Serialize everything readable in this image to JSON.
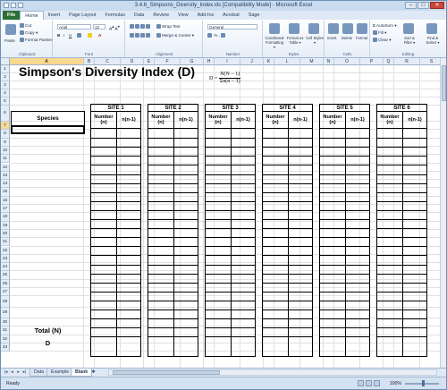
{
  "window": {
    "title": "3.4.6_Simpsons_Diversity_Index.xls [Compatibility Mode] - Microsoft Excel"
  },
  "ribbon_tabs": [
    "File",
    "Home",
    "Insert",
    "Page Layout",
    "Formulas",
    "Data",
    "Review",
    "View",
    "Add-Ins",
    "Acrobat",
    "Sage"
  ],
  "ribbon": {
    "clipboard": {
      "paste": "Paste",
      "cut": "Cut",
      "copy": "Copy ▾",
      "format_painter": "Format Painter",
      "label": "Clipboard"
    },
    "font": {
      "name": "Arial",
      "size": "12",
      "label": "Font"
    },
    "alignment": {
      "wrap": "Wrap Text",
      "merge": "Merge & Center ▾",
      "label": "Alignment"
    },
    "number": {
      "format": "General",
      "label": "Number"
    },
    "styles": {
      "conditional": "Conditional Formatting ▾",
      "format_table": "Format as Table ▾",
      "cell_styles": "Cell Styles ▾",
      "label": "Styles"
    },
    "cells": {
      "insert": "Insert",
      "delete": "Delete",
      "format": "Format",
      "label": "Cells"
    },
    "editing": {
      "autosum": "AutoSum ▾",
      "fill": "Fill ▾",
      "clear": "Clear ▾",
      "sort": "Sort & Filter ▾",
      "find": "Find & Select ▾",
      "label": "Editing"
    }
  },
  "columns": [
    "A",
    "B",
    "C",
    "D",
    "E",
    "F",
    "G",
    "H",
    "I",
    "J",
    "K",
    "L",
    "M",
    "N",
    "O",
    "P",
    "Q",
    "R",
    "S"
  ],
  "rows": [
    "1",
    "2",
    "3",
    "4",
    "5",
    "6",
    "7",
    "8",
    "9",
    "10",
    "11",
    "12",
    "13",
    "14",
    "15",
    "16",
    "17",
    "18",
    "19",
    "20",
    "21",
    "22",
    "23",
    "24",
    "25",
    "26",
    "27",
    "28",
    "29",
    "30",
    "31",
    "32",
    "33"
  ],
  "sheet": {
    "title": "Simpson's Diversity Index (D)",
    "formula_lhs": "D =",
    "formula_num": "N(N − 1)",
    "formula_den": "Σn(n − 1)",
    "species_header": "Species",
    "sites": [
      {
        "name": "SITE 1",
        "col1": "Number (n)",
        "col2": "n(n-1)"
      },
      {
        "name": "SITE 2",
        "col1": "Number (n)",
        "col2": "n(n-1)"
      },
      {
        "name": "SITE 3",
        "col1": "Number (n)",
        "col2": "n(n-1)"
      },
      {
        "name": "SITE 4",
        "col1": "Number (n)",
        "col2": "n(n-1)"
      },
      {
        "name": "SITE 5",
        "col1": "Number (n)",
        "col2": "n(n-1)"
      },
      {
        "name": "SITE 6",
        "col1": "Number (n)",
        "col2": "n(n-1)"
      }
    ],
    "total_label": "Total (N)",
    "d_label": "D"
  },
  "sheet_tabs": [
    "Data",
    "Example",
    "Blank"
  ],
  "status": {
    "ready": "Ready",
    "zoom": "100%"
  }
}
